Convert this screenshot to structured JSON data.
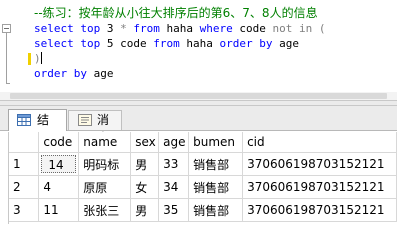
{
  "editor": {
    "lines": [
      {
        "parts": [
          {
            "cls": "comment",
            "text": "--练习：按年龄从小往大排序后的第6、7、8人的信息"
          }
        ]
      },
      {
        "parts": [
          {
            "cls": "kw",
            "text": "select top "
          },
          {
            "cls": "txt",
            "text": "3 "
          },
          {
            "cls": "gray",
            "text": "* "
          },
          {
            "cls": "kw",
            "text": "from "
          },
          {
            "cls": "txt",
            "text": "haha "
          },
          {
            "cls": "kw",
            "text": "where "
          },
          {
            "cls": "txt",
            "text": "code "
          },
          {
            "cls": "gray",
            "text": "not in ("
          }
        ]
      },
      {
        "parts": [
          {
            "cls": "kw",
            "text": "select top "
          },
          {
            "cls": "txt",
            "text": "5 "
          },
          {
            "cls": "txt",
            "text": "code "
          },
          {
            "cls": "kw",
            "text": "from "
          },
          {
            "cls": "txt",
            "text": "haha "
          },
          {
            "cls": "kw",
            "text": "order by "
          },
          {
            "cls": "txt",
            "text": "age"
          }
        ]
      },
      {
        "parts": [
          {
            "cls": "gray",
            "text": ")"
          }
        ],
        "caret": true
      },
      {
        "parts": [
          {
            "cls": "kw",
            "text": "order by "
          },
          {
            "cls": "txt",
            "text": "age"
          }
        ]
      }
    ]
  },
  "tabs": {
    "results_label": "结果",
    "messages_label": "消息"
  },
  "grid": {
    "columns": [
      "",
      "code",
      "name",
      "sex",
      "age",
      "bumen",
      "cid"
    ],
    "rows": [
      {
        "rownum": "1",
        "code": "14",
        "name": "明码标",
        "sex": "男",
        "age": "33",
        "bumen": "销售部",
        "cid": "370606198703152121"
      },
      {
        "rownum": "2",
        "code": "4",
        "name": "原原",
        "sex": "女",
        "age": "34",
        "bumen": "销售部",
        "cid": "370606198703152121"
      },
      {
        "rownum": "3",
        "code": "11",
        "name": "张张三",
        "sex": "男",
        "age": "35",
        "bumen": "销售部",
        "cid": "370606198703152121"
      }
    ]
  },
  "colors": {
    "keyword": "#0000ff",
    "comment": "#008000",
    "operator": "#808080",
    "change_bar": "#f0d000"
  }
}
